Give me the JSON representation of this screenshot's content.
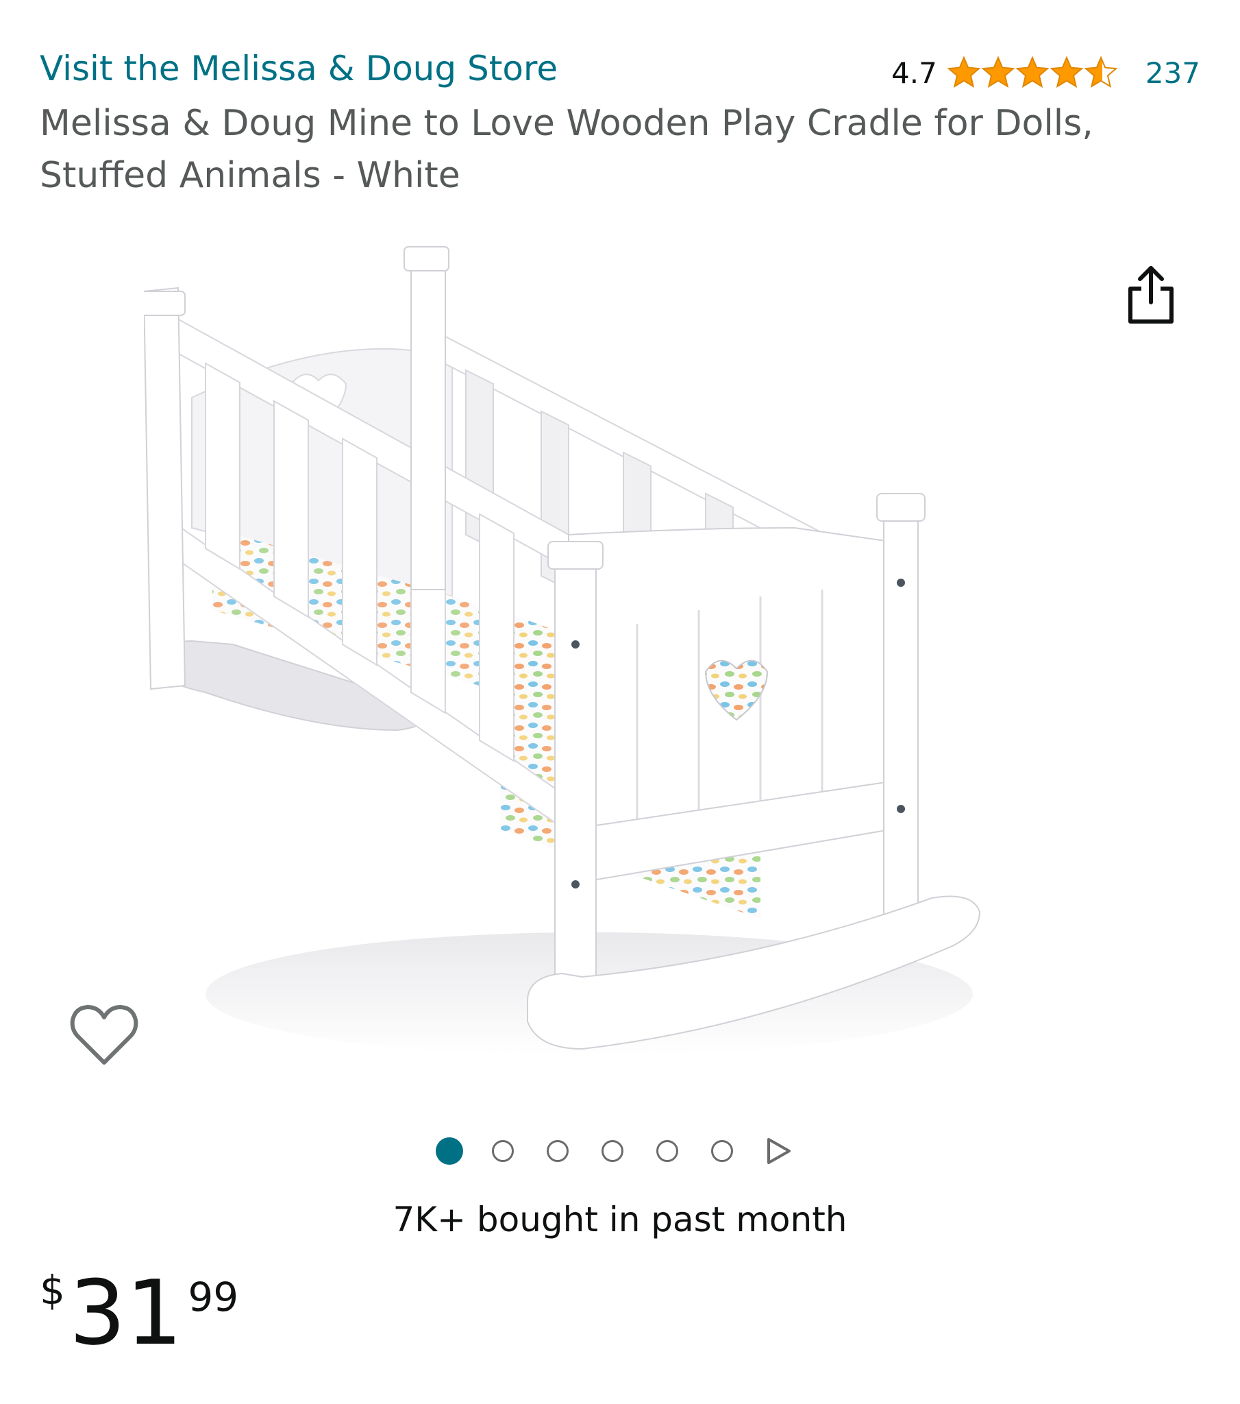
{
  "header": {
    "store_link": "Visit the Melissa & Doug Store",
    "rating_value": "4.7",
    "rating_stars": 4.7,
    "rating_max": 5,
    "rating_count": "237"
  },
  "product": {
    "title": "Melissa & Doug Mine to Love Wooden Play Cradle for Dolls, Stuffed Animals - White",
    "image_icon": "wooden-doll-cradle-image"
  },
  "actions": {
    "share_icon": "share-icon",
    "wishlist_icon": "heart-outline-icon"
  },
  "carousel": {
    "total_dots": 6,
    "active_index": 0,
    "next_icon": "play-triangle-icon"
  },
  "social_proof": {
    "bought_text": "7K+ bought in past month"
  },
  "price": {
    "symbol": "$",
    "whole": "31",
    "fraction": "99"
  },
  "colors": {
    "link": "#007185",
    "star": "#ff9900",
    "title_gray": "#565959",
    "active_dot": "#007185"
  }
}
